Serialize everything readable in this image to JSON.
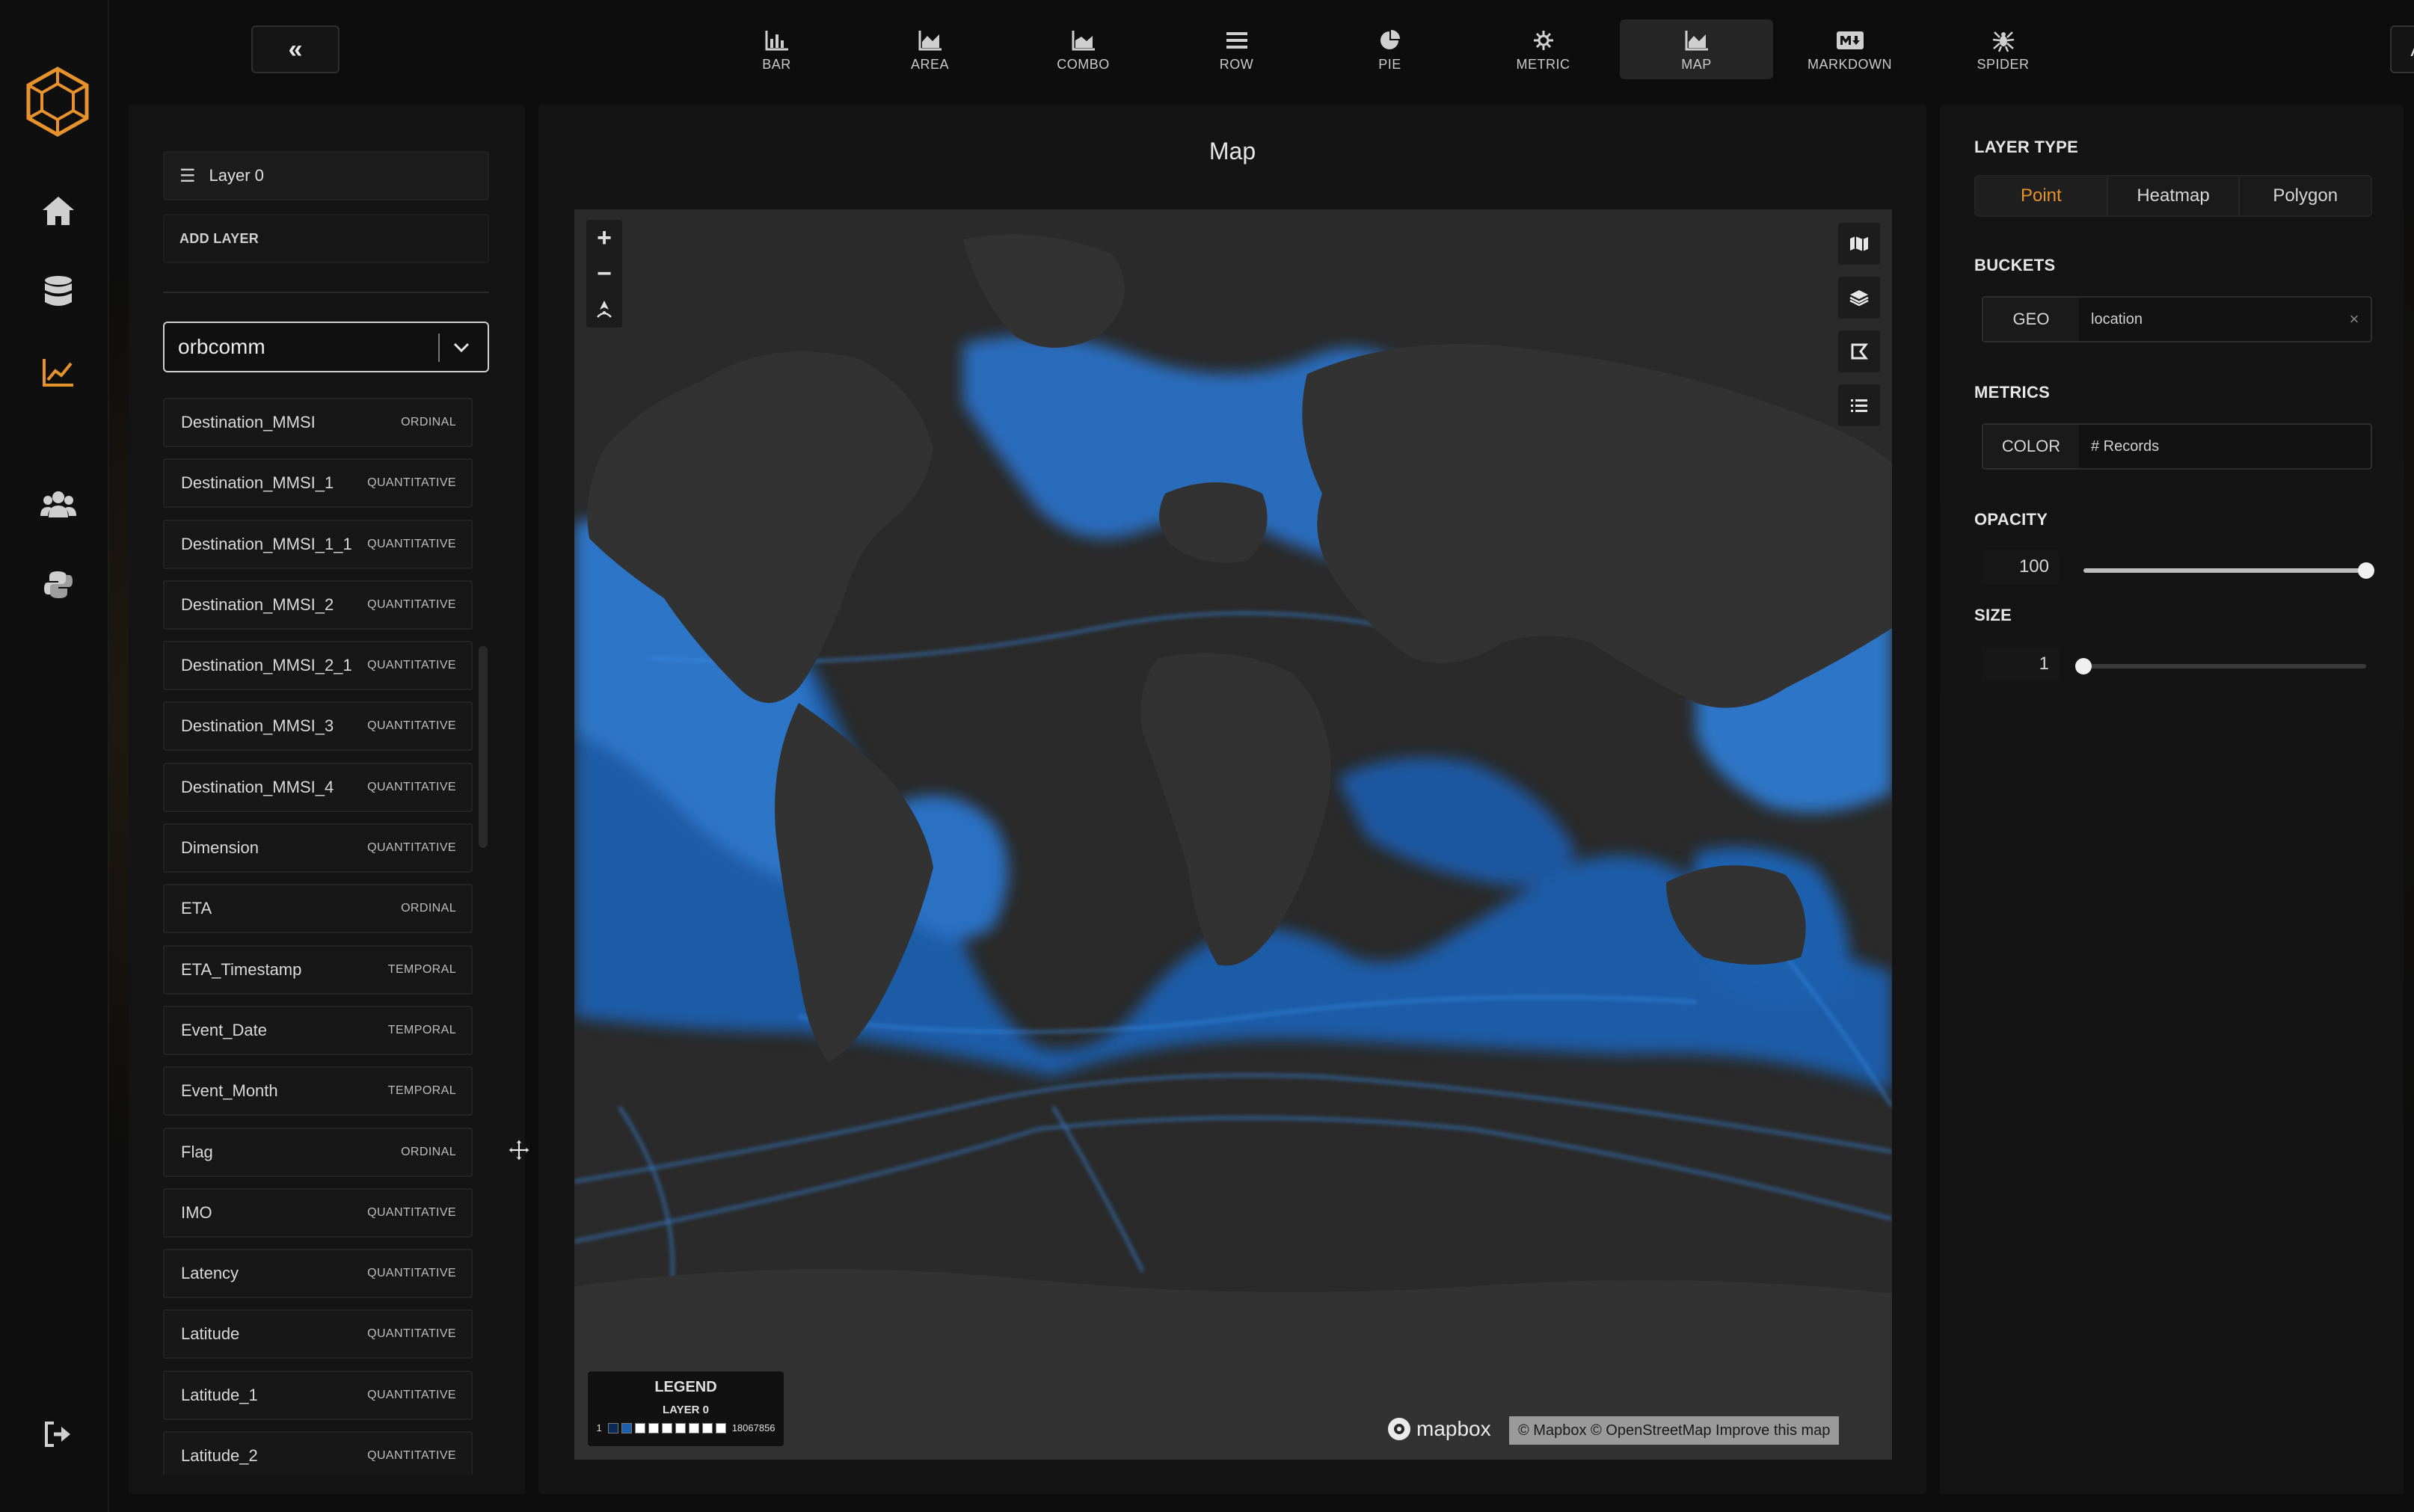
{
  "toolbar": {
    "collapse_label": "«",
    "chart_types": [
      {
        "label": "BAR",
        "icon": "bar-chart-icon"
      },
      {
        "label": "AREA",
        "icon": "area-chart-icon"
      },
      {
        "label": "COMBO",
        "icon": "combo-chart-icon"
      },
      {
        "label": "ROW",
        "icon": "row-chart-icon"
      },
      {
        "label": "PIE",
        "icon": "pie-chart-icon"
      },
      {
        "label": "METRIC",
        "icon": "metric-icon"
      },
      {
        "label": "MAP",
        "icon": "map-chart-icon",
        "active": true
      },
      {
        "label": "MARKDOWN",
        "icon": "markdown-icon"
      },
      {
        "label": "SPIDER",
        "icon": "spider-chart-icon"
      }
    ],
    "apply_label": "APPLY"
  },
  "nav": {
    "items": [
      "home-icon",
      "database-icon",
      "chart-icon",
      "users-icon",
      "python-icon"
    ],
    "active": "chart-icon",
    "bottom": "logout-icon",
    "accent": "#e8922c"
  },
  "layers": {
    "current": "Layer 0",
    "add_label": "ADD LAYER"
  },
  "dataset": {
    "selected": "orbcomm"
  },
  "fields": [
    {
      "name": "Destination_MMSI",
      "type": "ORDINAL"
    },
    {
      "name": "Destination_MMSI_1",
      "type": "QUANTITATIVE"
    },
    {
      "name": "Destination_MMSI_1_1",
      "type": "QUANTITATIVE"
    },
    {
      "name": "Destination_MMSI_2",
      "type": "QUANTITATIVE"
    },
    {
      "name": "Destination_MMSI_2_1",
      "type": "QUANTITATIVE"
    },
    {
      "name": "Destination_MMSI_3",
      "type": "QUANTITATIVE"
    },
    {
      "name": "Destination_MMSI_4",
      "type": "QUANTITATIVE"
    },
    {
      "name": "Dimension",
      "type": "QUANTITATIVE"
    },
    {
      "name": "ETA",
      "type": "ORDINAL"
    },
    {
      "name": "ETA_Timestamp",
      "type": "TEMPORAL"
    },
    {
      "name": "Event_Date",
      "type": "TEMPORAL"
    },
    {
      "name": "Event_Month",
      "type": "TEMPORAL"
    },
    {
      "name": "Flag",
      "type": "ORDINAL"
    },
    {
      "name": "IMO",
      "type": "QUANTITATIVE"
    },
    {
      "name": "Latency",
      "type": "QUANTITATIVE"
    },
    {
      "name": "Latitude",
      "type": "QUANTITATIVE"
    },
    {
      "name": "Latitude_1",
      "type": "QUANTITATIVE"
    },
    {
      "name": "Latitude_2",
      "type": "QUANTITATIVE"
    }
  ],
  "map": {
    "title": "Map",
    "zoom_in": "+",
    "zoom_out": "−",
    "legend": {
      "title": "LEGEND",
      "layer": "LAYER 0",
      "min": "1",
      "max": "18067856",
      "colors": [
        "#0b2a55",
        "#1b5fae",
        "#ffffff",
        "#ffffff",
        "#ffffff",
        "#ffffff",
        "#ffffff",
        "#ffffff",
        "#ffffff"
      ]
    },
    "logo": "mapbox",
    "attribution": "© Mapbox © OpenStreetMap Improve this map"
  },
  "config": {
    "layer_type_label": "LAYER TYPE",
    "layer_types": [
      "Point",
      "Heatmap",
      "Polygon"
    ],
    "layer_type_selected": "Point",
    "buckets_label": "BUCKETS",
    "bucket": {
      "key": "GEO",
      "value": "location",
      "remove": "×"
    },
    "metrics_label": "METRICS",
    "metric": {
      "key": "COLOR",
      "value": "# Records"
    },
    "opacity_label": "OPACITY",
    "opacity_value": "100",
    "opacity_fraction": 1.0,
    "size_label": "SIZE",
    "size_value": "1",
    "size_fraction": 0.0
  }
}
